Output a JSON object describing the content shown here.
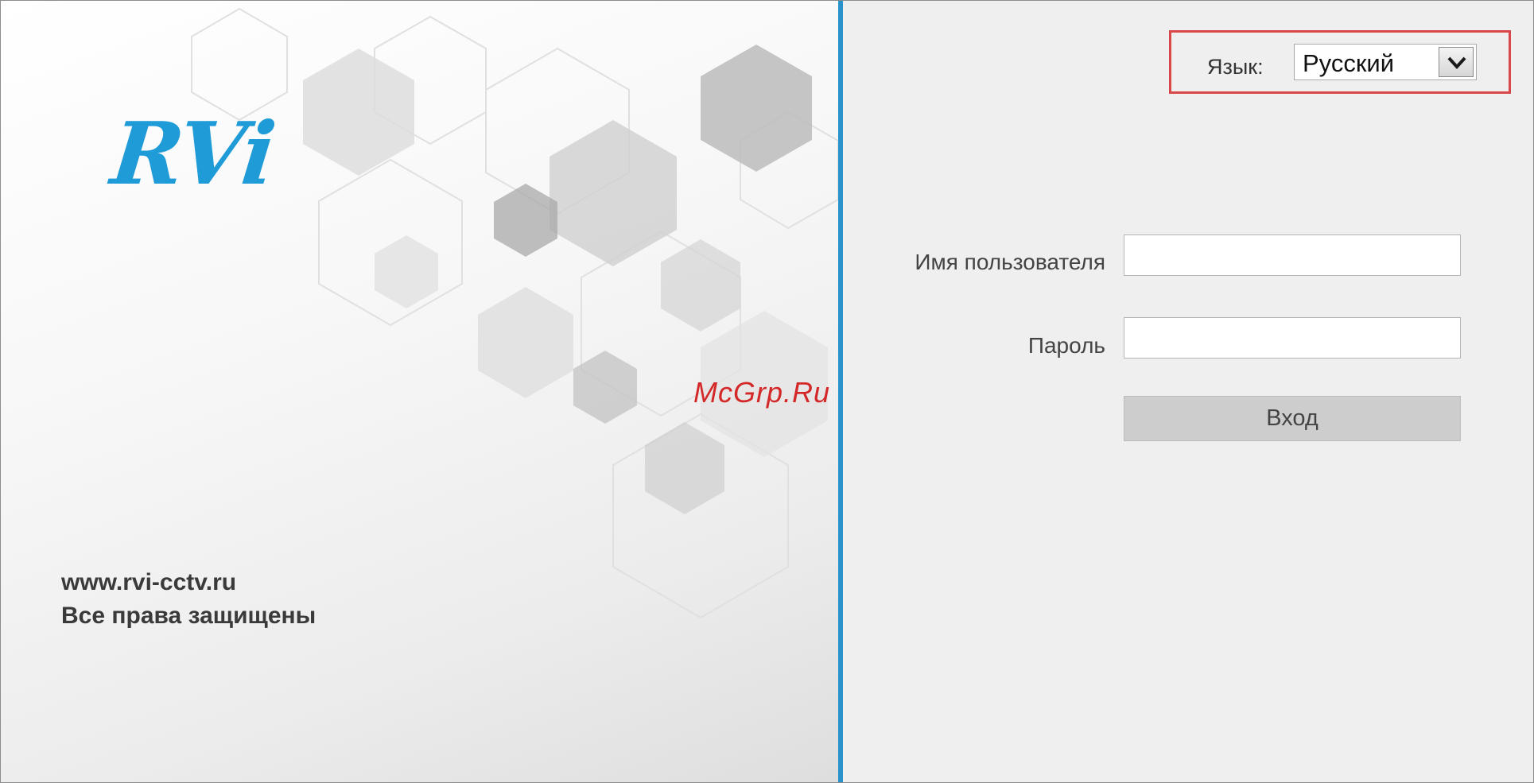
{
  "brand": {
    "logo_text": "RVi",
    "website": "www.rvi-cctv.ru",
    "copyright": "Все права защищены",
    "accent_color": "#1f9bd7"
  },
  "language": {
    "label": "Язык:",
    "selected": "Русский",
    "highlight_color": "#d9474b"
  },
  "login_form": {
    "username_label": "Имя пользователя",
    "username_value": "",
    "password_label": "Пароль",
    "password_value": "",
    "submit_label": "Вход"
  },
  "watermark": "McGrp.Ru",
  "icons": {
    "select_arrow": "chevron-down-icon"
  }
}
